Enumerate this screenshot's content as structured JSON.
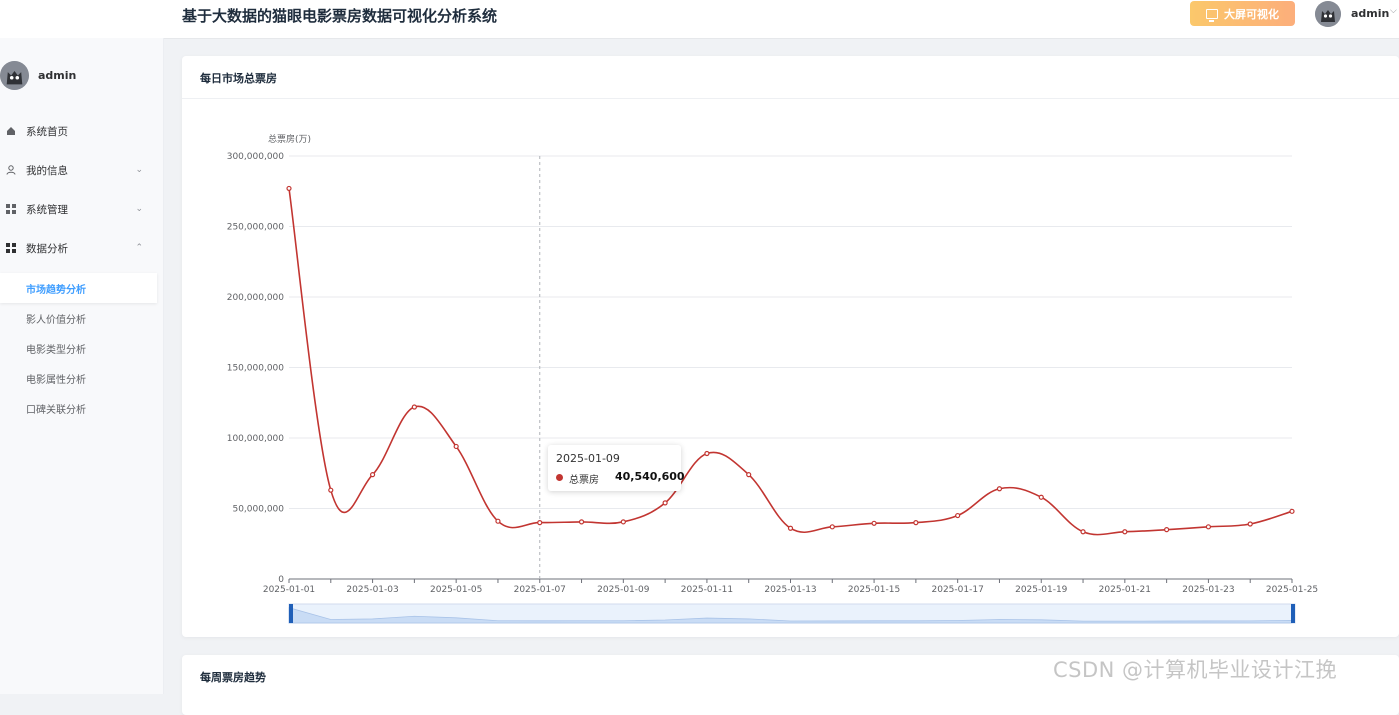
{
  "app": {
    "title": "基于大数据的猫眼电影票房数据可视化分析系统",
    "bigscreen_label": "大屏可视化",
    "username": "admin"
  },
  "sidebar": {
    "username": "admin",
    "items": [
      {
        "label": "系统首页",
        "icon": "home-icon"
      },
      {
        "label": "我的信息",
        "icon": "user-icon",
        "expandable": true
      },
      {
        "label": "系统管理",
        "icon": "grid-icon",
        "expandable": true
      },
      {
        "label": "数据分析",
        "icon": "grid-icon",
        "expandable": true,
        "expanded": true
      }
    ],
    "subitems": [
      {
        "label": "市场趋势分析",
        "active": true
      },
      {
        "label": "影人价值分析"
      },
      {
        "label": "电影类型分析"
      },
      {
        "label": "电影属性分析"
      },
      {
        "label": "口碑关联分析"
      }
    ]
  },
  "panels": {
    "daily_title": "每日市场总票房",
    "weekly_title": "每周票房趋势"
  },
  "chart_data": {
    "type": "line",
    "ylabel": "总票房(万)",
    "ylim": [
      0,
      300000000
    ],
    "yticks": [
      "0",
      "50,000,000",
      "100,000,000",
      "150,000,000",
      "200,000,000",
      "250,000,000",
      "300,000,000"
    ],
    "x": [
      "2025-01-01",
      "2025-01-02",
      "2025-01-03",
      "2025-01-04",
      "2025-01-05",
      "2025-01-06",
      "2025-01-07",
      "2025-01-08",
      "2025-01-09",
      "2025-01-10",
      "2025-01-11",
      "2025-01-12",
      "2025-01-13",
      "2025-01-14",
      "2025-01-15",
      "2025-01-16",
      "2025-01-17",
      "2025-01-18",
      "2025-01-19",
      "2025-01-20",
      "2025-01-21",
      "2025-01-22",
      "2025-01-23",
      "2025-01-24",
      "2025-01-25"
    ],
    "xtick_labels": [
      "2025-01-01",
      "2025-01-03",
      "2025-01-05",
      "2025-01-07",
      "2025-01-09",
      "2025-01-11",
      "2025-01-13",
      "2025-01-15",
      "2025-01-17",
      "2025-01-19",
      "2025-01-21",
      "2025-01-23",
      "2025-01-25"
    ],
    "series": [
      {
        "name": "总票房",
        "color": "#c23531",
        "values": [
          277000000,
          63000000,
          74000000,
          122000000,
          94000000,
          41000000,
          40000000,
          40500000,
          40540600,
          54000000,
          89000000,
          74000000,
          36000000,
          37000000,
          39500000,
          40000000,
          45000000,
          64000000,
          58000000,
          33500000,
          33500000,
          35000000,
          37000000,
          39000000,
          48000000
        ]
      }
    ],
    "tooltip": {
      "date": "2025-01-09",
      "series": "总票房",
      "value": "40,540,600"
    },
    "grid": true,
    "datazoom": true
  },
  "watermark": "CSDN @计算机毕业设计江挽"
}
